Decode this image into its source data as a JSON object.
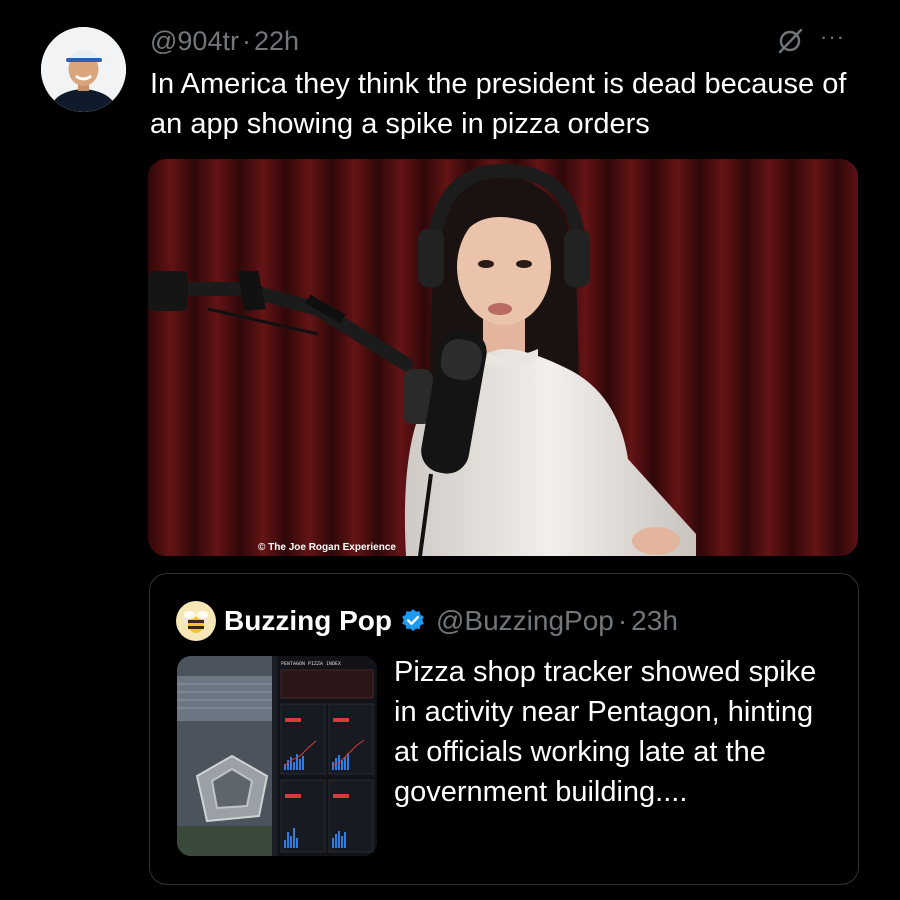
{
  "tweet": {
    "handle": "@904tr",
    "time_separator": "·",
    "time": "22h",
    "text": "In America they think the president is dead because of an app showing a spike in pizza orders",
    "icons": {
      "grok": "grok-slash-icon",
      "more": "more-options-icon"
    },
    "more_glyph": "···"
  },
  "media": {
    "watermark": "© The Joe Rogan Experience"
  },
  "quoted_tweet": {
    "name": "Buzzing Pop",
    "handle": "@BuzzingPop",
    "time_separator": "·",
    "time": "23h",
    "text": "Pizza shop tracker showed spike in activity near Pentagon, hinting at officials working late at the government building....",
    "thumbnail_title": "PENTAGON PIZZA INDEX"
  },
  "colors": {
    "background": "#000000",
    "text": "#ffffff",
    "muted": "#71767b",
    "verified": "#1d9bf0",
    "border": "#2f3336",
    "curtain": "#6b1416"
  }
}
